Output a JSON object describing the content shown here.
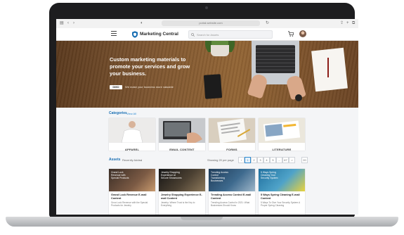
{
  "browser": {
    "url": "portal.website.com"
  },
  "header": {
    "brand": "Marketing Central",
    "search_placeholder": "Search for Assets"
  },
  "hero": {
    "headline": "Custom marketing materials to promote your services and grow your business.",
    "tagline": "We make your business more valuable",
    "logo_text": "DMO"
  },
  "categories": {
    "title": "Categories",
    "view_all": "View All",
    "items": [
      {
        "label": "APPAREL"
      },
      {
        "label": "EMAIL CONTENT"
      },
      {
        "label": "FORMS"
      },
      {
        "label": "LITERATURE"
      }
    ]
  },
  "assets": {
    "title": "Assets",
    "sort_label": "Recently Added",
    "per_page": "Showing 20 per page",
    "pages": [
      "1",
      "2",
      "3",
      "4",
      "5",
      "...",
      "67",
      ">",
      "20"
    ],
    "cards": [
      {
        "title": "Grand Lock Revenue E-mail Content",
        "desc": "Grow Lock Revenue with the Special Products for Jewelry",
        "overlay": "Grand Lock Revenue with Special Products"
      },
      {
        "title": "Jewelry Shopping Experience E-mail Content",
        "desc": "Jewelry: Where Trust is the Key to Everything",
        "overlay": "Jewelry Shopping Experience at Secure Showrooms"
      },
      {
        "title": "Trending Access Control E-mail Content",
        "desc": "Trending Access Control in 2021: What Businesses Should Know",
        "overlay": "Trending Access Control Transforming Businesses"
      },
      {
        "title": "5 Ways Spring Cleaning E-mail Content",
        "desc": "5 Ways To Give Your Security System A Proper Spring Cleaning",
        "overlay": "5 Ways Spring Cleaning Your Security System"
      }
    ]
  }
}
